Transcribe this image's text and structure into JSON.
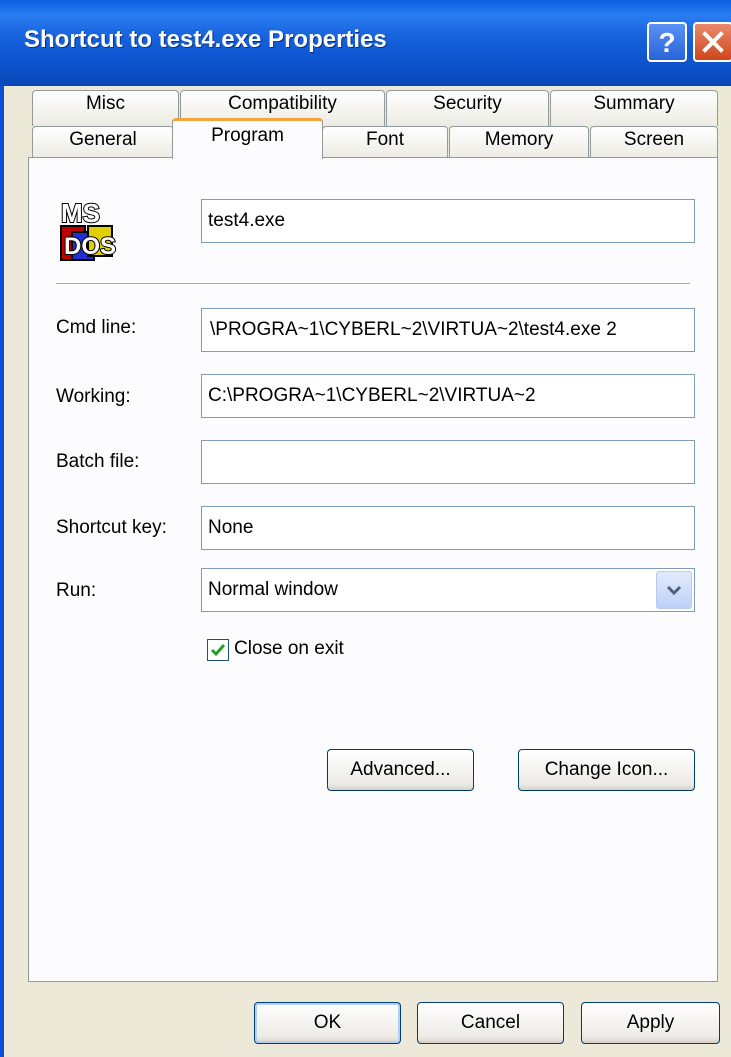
{
  "window": {
    "title": "Shortcut to test4.exe Properties"
  },
  "tabs_back": [
    {
      "label": "Misc"
    },
    {
      "label": "Compatibility"
    },
    {
      "label": "Security"
    },
    {
      "label": "Summary"
    }
  ],
  "tabs_front": [
    {
      "label": "General"
    },
    {
      "label": "Program",
      "active": true
    },
    {
      "label": "Font"
    },
    {
      "label": "Memory"
    },
    {
      "label": "Screen"
    }
  ],
  "program": {
    "icon_name": "ms-dos-icon",
    "name_value": "test4.exe",
    "cmd_line": {
      "label": "Cmd line:",
      "value": "\\PROGRA~1\\CYBERL~2\\VIRTUA~2\\test4.exe 2"
    },
    "working": {
      "label": "Working:",
      "value": "C:\\PROGRA~1\\CYBERL~2\\VIRTUA~2"
    },
    "batch_file": {
      "label": "Batch file:",
      "value": ""
    },
    "shortcut_key": {
      "label": "Shortcut key:",
      "value": "None"
    },
    "run": {
      "label": "Run:",
      "value": "Normal window"
    },
    "close_on_exit": {
      "label": "Close on exit",
      "checked": true
    },
    "advanced_label": "Advanced...",
    "change_icon_label": "Change Icon..."
  },
  "buttons": {
    "ok": "OK",
    "cancel": "Cancel",
    "apply": "Apply"
  },
  "colors": {
    "titlebar": "#0a5fe0",
    "active_tab_accent": "#f3a53a",
    "dialog_bg": "#ece9d8"
  }
}
